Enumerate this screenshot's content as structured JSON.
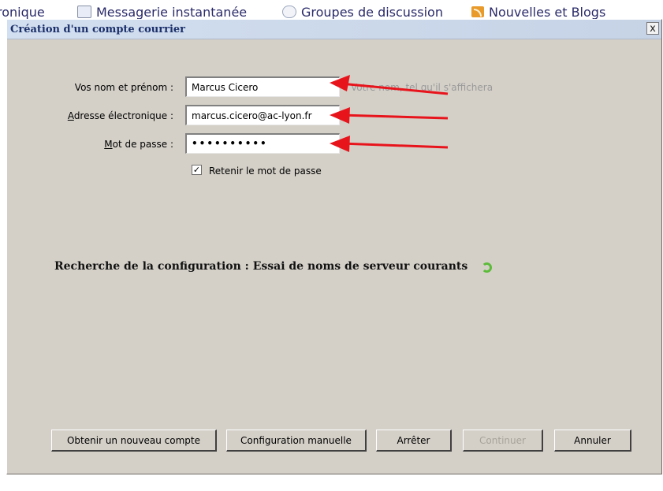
{
  "background_tabs": [
    {
      "label": "ronique",
      "icon": "none"
    },
    {
      "label": "Messagerie instantanée",
      "icon": "chat-icon"
    },
    {
      "label": "Groupes de discussion",
      "icon": "newsgroup-icon"
    },
    {
      "label": "Nouvelles et Blogs",
      "icon": "rss-icon"
    }
  ],
  "dialog": {
    "title": "Création d'un compte courrier",
    "close_label": "x"
  },
  "form": {
    "name_label": "Vos nom et prénom :",
    "name_value": "Marcus Cicero",
    "name_hint": "Votre nom, tel qu'il s'affichera",
    "email_label": "Adresse électronique :",
    "email_value": "marcus.cicero@ac-lyon.fr",
    "password_label": "Mot de passe :",
    "password_value": "••••••••••",
    "remember_label": "Retenir le mot de passe",
    "remember_checked": true
  },
  "status": {
    "text": "Recherche de la configuration : Essai de noms de serveur courants"
  },
  "buttons": {
    "new_account": "Obtenir un nouveau compte",
    "manual_config": "Configuration manuelle",
    "stop": "Arrêter",
    "continue": "Continuer",
    "cancel": "Annuler"
  },
  "colors": {
    "dialog_bg": "#d4d0c8",
    "annotation_arrow": "#e8141c",
    "spinner": "#5dbb3a"
  }
}
